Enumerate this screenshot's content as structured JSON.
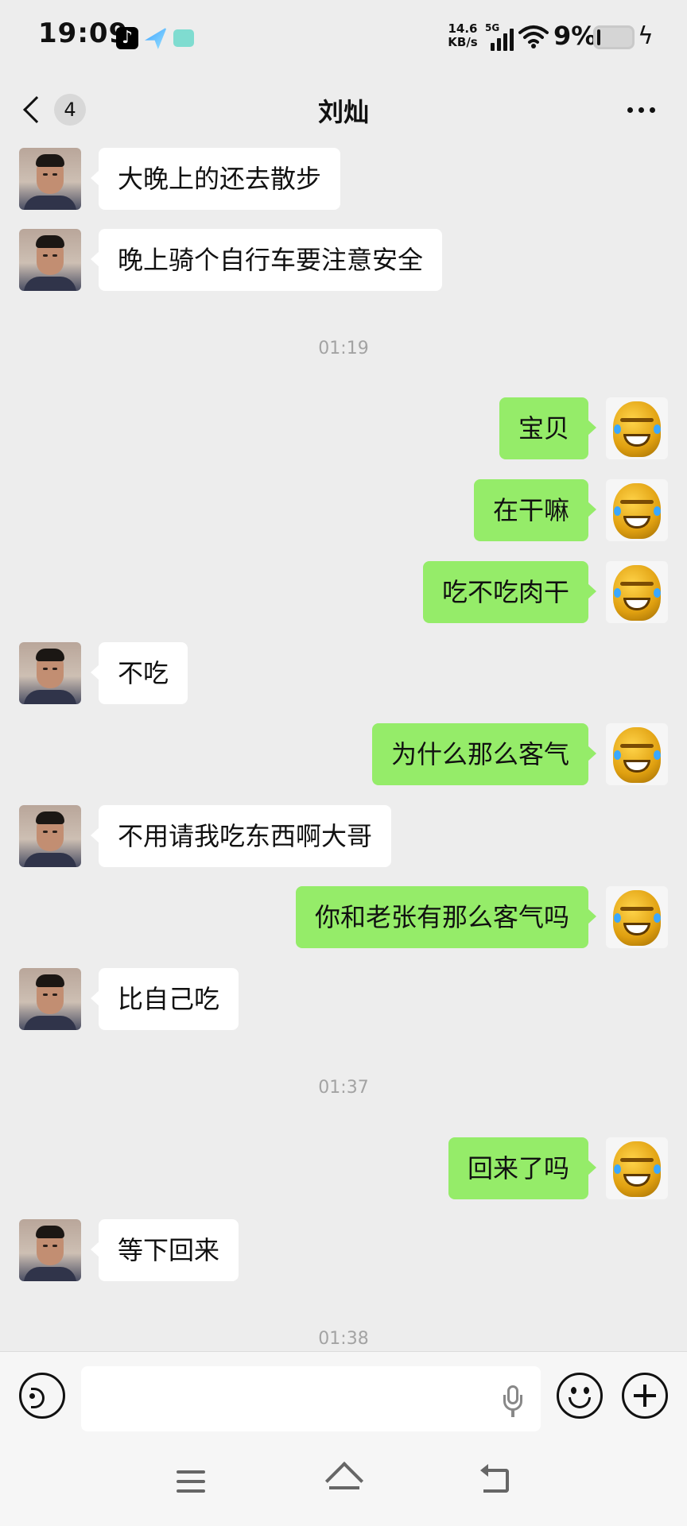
{
  "status_bar": {
    "time": "19:09",
    "net_speed_value": "14.6",
    "net_speed_unit": "KB/s",
    "network_type": "5G",
    "battery_percent": "9%",
    "battery_level": 0.09
  },
  "header": {
    "unread_count": "4",
    "title": "刘灿"
  },
  "messages": [
    {
      "from": "contact",
      "text": "大晚上的还去散步"
    },
    {
      "from": "contact",
      "text": "晚上骑个自行车要注意安全"
    },
    {
      "type": "time",
      "text": "01:19"
    },
    {
      "from": "me",
      "text": "宝贝"
    },
    {
      "from": "me",
      "text": "在干嘛"
    },
    {
      "from": "me",
      "text": "吃不吃肉干"
    },
    {
      "from": "contact",
      "text": "不吃"
    },
    {
      "from": "me",
      "text": "为什么那么客气"
    },
    {
      "from": "contact",
      "text": "不用请我吃东西啊大哥"
    },
    {
      "from": "me",
      "text": "你和老张有那么客气吗"
    },
    {
      "from": "contact",
      "text": "比自己吃"
    },
    {
      "type": "time",
      "text": "01:37"
    },
    {
      "from": "me",
      "text": "回来了吗"
    },
    {
      "from": "contact",
      "text": "等下回来"
    },
    {
      "type": "time",
      "text": "01:38"
    }
  ],
  "input": {
    "value": "",
    "placeholder": ""
  },
  "colors": {
    "background": "#ededed",
    "outgoing_bubble": "#95ec69",
    "incoming_bubble": "#ffffff",
    "timestamp": "#a3a3a3"
  },
  "icons": {
    "status": [
      "tiktok-icon",
      "navigation-app-icon",
      "message-app-icon",
      "signal-icon",
      "wifi-icon",
      "battery-icon",
      "charging-icon"
    ],
    "header": [
      "chevron-left-icon",
      "more-icon"
    ],
    "input_bar": [
      "voice-icon",
      "microphone-icon",
      "emoji-icon",
      "plus-icon"
    ],
    "nav_bar": [
      "menu-icon",
      "home-icon",
      "back-icon"
    ]
  }
}
